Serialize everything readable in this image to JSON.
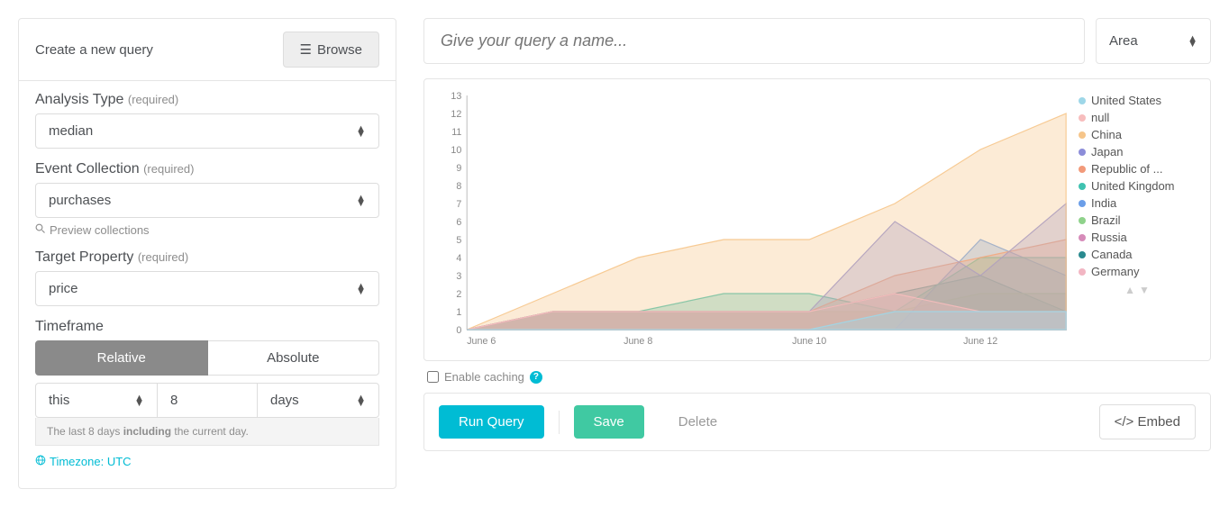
{
  "left": {
    "title": "Create a new query",
    "browse": "Browse",
    "analysis": {
      "label": "Analysis Type",
      "req": "(required)",
      "value": "median"
    },
    "collection": {
      "label": "Event Collection",
      "req": "(required)",
      "value": "purchases",
      "preview": "Preview collections"
    },
    "target": {
      "label": "Target Property",
      "req": "(required)",
      "value": "price"
    },
    "timeframe": {
      "label": "Timeframe",
      "relative": "Relative",
      "absolute": "Absolute",
      "val1": "this",
      "val2": "8",
      "val3": "days",
      "note_pre": "The last 8 days ",
      "note_bold": "including",
      "note_post": " the current day."
    },
    "timezone": "Timezone: UTC"
  },
  "right": {
    "name_placeholder": "Give your query a name...",
    "chart_type": "Area",
    "cache": "Enable caching",
    "run": "Run Query",
    "save": "Save",
    "delete": "Delete",
    "embed": "Embed"
  },
  "legend_colors": {
    "United States": "#9ed7e8",
    "null": "#f7bdbd",
    "China": "#f6c58a",
    "Japan": "#8c8dd9",
    "Republic of ...": "#f29a7a",
    "United Kingdom": "#3fc2b0",
    "India": "#6b9ee8",
    "Brazil": "#8fd28b",
    "Russia": "#d68bb9",
    "Canada": "#2a8a8f",
    "Germany": "#f2b6c3"
  },
  "chart_data": {
    "type": "area",
    "title": "",
    "xlabel": "",
    "ylabel": "",
    "ylim": [
      0,
      13
    ],
    "x_ticks": [
      "June 6",
      "June 8",
      "June 10",
      "June 12"
    ],
    "categories": [
      "June 6",
      "June 7",
      "June 8",
      "June 9",
      "June 10",
      "June 11",
      "June 12",
      "June 13"
    ],
    "series": [
      {
        "name": "United States",
        "values": [
          0,
          0,
          0,
          0,
          0,
          1,
          1,
          1
        ],
        "color": "#9ed7e8"
      },
      {
        "name": "null",
        "values": [
          0,
          1,
          1,
          1,
          1,
          2,
          1,
          1
        ],
        "color": "#f7bdbd"
      },
      {
        "name": "China",
        "values": [
          0,
          2,
          4,
          5,
          5,
          7,
          10,
          12
        ],
        "color": "#f6c58a"
      },
      {
        "name": "Japan",
        "values": [
          0,
          1,
          1,
          1,
          1,
          6,
          3,
          7
        ],
        "color": "#8c8dd9"
      },
      {
        "name": "Republic of ...",
        "values": [
          0,
          1,
          1,
          1,
          1,
          3,
          4,
          5
        ],
        "color": "#f29a7a"
      },
      {
        "name": "United Kingdom",
        "values": [
          0,
          1,
          1,
          2,
          2,
          1,
          4,
          4
        ],
        "color": "#3fc2b0"
      },
      {
        "name": "India",
        "values": [
          0,
          0,
          0,
          0,
          0,
          0,
          5,
          3
        ],
        "color": "#6b9ee8"
      },
      {
        "name": "Brazil",
        "values": [
          0,
          1,
          1,
          1,
          1,
          1,
          2,
          2
        ],
        "color": "#8fd28b"
      },
      {
        "name": "Russia",
        "values": [
          0,
          1,
          1,
          1,
          1,
          1,
          1,
          1
        ],
        "color": "#d68bb9"
      },
      {
        "name": "Canada",
        "values": [
          0,
          1,
          1,
          1,
          1,
          2,
          3,
          1
        ],
        "color": "#2a8a8f"
      },
      {
        "name": "Germany",
        "values": [
          0,
          0,
          0,
          0,
          0,
          0,
          0,
          0
        ],
        "color": "#f2b6c3"
      }
    ]
  }
}
